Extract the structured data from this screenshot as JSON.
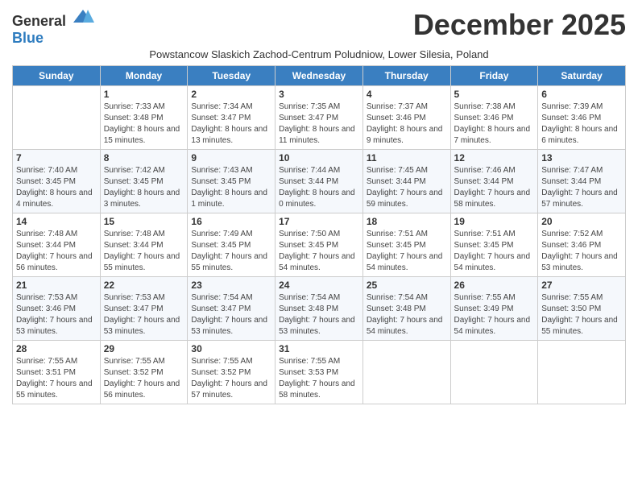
{
  "header": {
    "logo_general": "General",
    "logo_blue": "Blue",
    "month_title": "December 2025",
    "subtitle": "Powstancow Slaskich Zachod-Centrum Poludniow, Lower Silesia, Poland"
  },
  "days_of_week": [
    "Sunday",
    "Monday",
    "Tuesday",
    "Wednesday",
    "Thursday",
    "Friday",
    "Saturday"
  ],
  "weeks": [
    [
      {
        "day": "",
        "sunrise": "",
        "sunset": "",
        "daylight": "",
        "empty": true
      },
      {
        "day": "1",
        "sunrise": "Sunrise: 7:33 AM",
        "sunset": "Sunset: 3:48 PM",
        "daylight": "Daylight: 8 hours and 15 minutes."
      },
      {
        "day": "2",
        "sunrise": "Sunrise: 7:34 AM",
        "sunset": "Sunset: 3:47 PM",
        "daylight": "Daylight: 8 hours and 13 minutes."
      },
      {
        "day": "3",
        "sunrise": "Sunrise: 7:35 AM",
        "sunset": "Sunset: 3:47 PM",
        "daylight": "Daylight: 8 hours and 11 minutes."
      },
      {
        "day": "4",
        "sunrise": "Sunrise: 7:37 AM",
        "sunset": "Sunset: 3:46 PM",
        "daylight": "Daylight: 8 hours and 9 minutes."
      },
      {
        "day": "5",
        "sunrise": "Sunrise: 7:38 AM",
        "sunset": "Sunset: 3:46 PM",
        "daylight": "Daylight: 8 hours and 7 minutes."
      },
      {
        "day": "6",
        "sunrise": "Sunrise: 7:39 AM",
        "sunset": "Sunset: 3:46 PM",
        "daylight": "Daylight: 8 hours and 6 minutes."
      }
    ],
    [
      {
        "day": "7",
        "sunrise": "Sunrise: 7:40 AM",
        "sunset": "Sunset: 3:45 PM",
        "daylight": "Daylight: 8 hours and 4 minutes."
      },
      {
        "day": "8",
        "sunrise": "Sunrise: 7:42 AM",
        "sunset": "Sunset: 3:45 PM",
        "daylight": "Daylight: 8 hours and 3 minutes."
      },
      {
        "day": "9",
        "sunrise": "Sunrise: 7:43 AM",
        "sunset": "Sunset: 3:45 PM",
        "daylight": "Daylight: 8 hours and 1 minute."
      },
      {
        "day": "10",
        "sunrise": "Sunrise: 7:44 AM",
        "sunset": "Sunset: 3:44 PM",
        "daylight": "Daylight: 8 hours and 0 minutes."
      },
      {
        "day": "11",
        "sunrise": "Sunrise: 7:45 AM",
        "sunset": "Sunset: 3:44 PM",
        "daylight": "Daylight: 7 hours and 59 minutes."
      },
      {
        "day": "12",
        "sunrise": "Sunrise: 7:46 AM",
        "sunset": "Sunset: 3:44 PM",
        "daylight": "Daylight: 7 hours and 58 minutes."
      },
      {
        "day": "13",
        "sunrise": "Sunrise: 7:47 AM",
        "sunset": "Sunset: 3:44 PM",
        "daylight": "Daylight: 7 hours and 57 minutes."
      }
    ],
    [
      {
        "day": "14",
        "sunrise": "Sunrise: 7:48 AM",
        "sunset": "Sunset: 3:44 PM",
        "daylight": "Daylight: 7 hours and 56 minutes."
      },
      {
        "day": "15",
        "sunrise": "Sunrise: 7:48 AM",
        "sunset": "Sunset: 3:44 PM",
        "daylight": "Daylight: 7 hours and 55 minutes."
      },
      {
        "day": "16",
        "sunrise": "Sunrise: 7:49 AM",
        "sunset": "Sunset: 3:45 PM",
        "daylight": "Daylight: 7 hours and 55 minutes."
      },
      {
        "day": "17",
        "sunrise": "Sunrise: 7:50 AM",
        "sunset": "Sunset: 3:45 PM",
        "daylight": "Daylight: 7 hours and 54 minutes."
      },
      {
        "day": "18",
        "sunrise": "Sunrise: 7:51 AM",
        "sunset": "Sunset: 3:45 PM",
        "daylight": "Daylight: 7 hours and 54 minutes."
      },
      {
        "day": "19",
        "sunrise": "Sunrise: 7:51 AM",
        "sunset": "Sunset: 3:45 PM",
        "daylight": "Daylight: 7 hours and 54 minutes."
      },
      {
        "day": "20",
        "sunrise": "Sunrise: 7:52 AM",
        "sunset": "Sunset: 3:46 PM",
        "daylight": "Daylight: 7 hours and 53 minutes."
      }
    ],
    [
      {
        "day": "21",
        "sunrise": "Sunrise: 7:53 AM",
        "sunset": "Sunset: 3:46 PM",
        "daylight": "Daylight: 7 hours and 53 minutes."
      },
      {
        "day": "22",
        "sunrise": "Sunrise: 7:53 AM",
        "sunset": "Sunset: 3:47 PM",
        "daylight": "Daylight: 7 hours and 53 minutes."
      },
      {
        "day": "23",
        "sunrise": "Sunrise: 7:54 AM",
        "sunset": "Sunset: 3:47 PM",
        "daylight": "Daylight: 7 hours and 53 minutes."
      },
      {
        "day": "24",
        "sunrise": "Sunrise: 7:54 AM",
        "sunset": "Sunset: 3:48 PM",
        "daylight": "Daylight: 7 hours and 53 minutes."
      },
      {
        "day": "25",
        "sunrise": "Sunrise: 7:54 AM",
        "sunset": "Sunset: 3:48 PM",
        "daylight": "Daylight: 7 hours and 54 minutes."
      },
      {
        "day": "26",
        "sunrise": "Sunrise: 7:55 AM",
        "sunset": "Sunset: 3:49 PM",
        "daylight": "Daylight: 7 hours and 54 minutes."
      },
      {
        "day": "27",
        "sunrise": "Sunrise: 7:55 AM",
        "sunset": "Sunset: 3:50 PM",
        "daylight": "Daylight: 7 hours and 55 minutes."
      }
    ],
    [
      {
        "day": "28",
        "sunrise": "Sunrise: 7:55 AM",
        "sunset": "Sunset: 3:51 PM",
        "daylight": "Daylight: 7 hours and 55 minutes."
      },
      {
        "day": "29",
        "sunrise": "Sunrise: 7:55 AM",
        "sunset": "Sunset: 3:52 PM",
        "daylight": "Daylight: 7 hours and 56 minutes."
      },
      {
        "day": "30",
        "sunrise": "Sunrise: 7:55 AM",
        "sunset": "Sunset: 3:52 PM",
        "daylight": "Daylight: 7 hours and 57 minutes."
      },
      {
        "day": "31",
        "sunrise": "Sunrise: 7:55 AM",
        "sunset": "Sunset: 3:53 PM",
        "daylight": "Daylight: 7 hours and 58 minutes."
      },
      {
        "day": "",
        "sunrise": "",
        "sunset": "",
        "daylight": "",
        "empty": true
      },
      {
        "day": "",
        "sunrise": "",
        "sunset": "",
        "daylight": "",
        "empty": true
      },
      {
        "day": "",
        "sunrise": "",
        "sunset": "",
        "daylight": "",
        "empty": true
      }
    ]
  ]
}
